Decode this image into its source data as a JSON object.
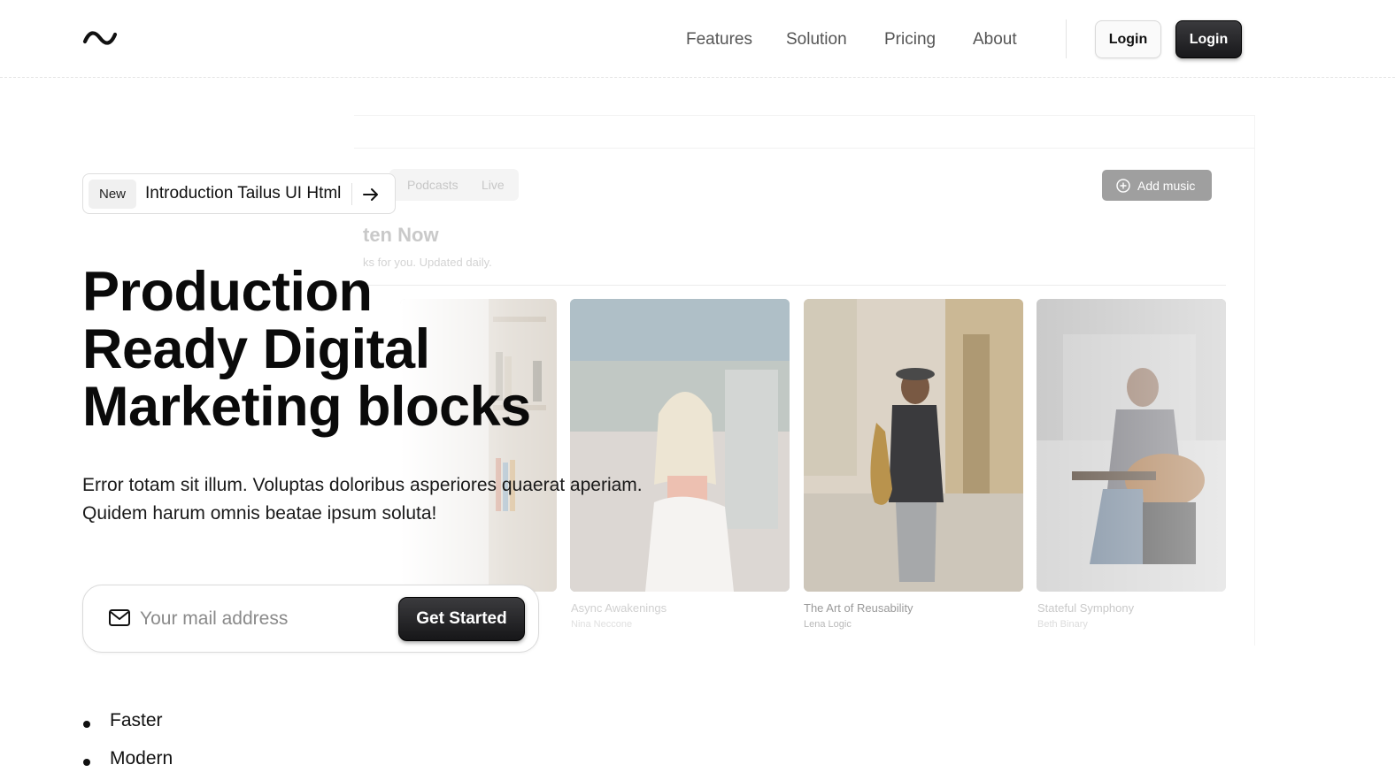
{
  "header": {
    "logo": "tilde-logo-icon",
    "nav": [
      "Features",
      "Solution",
      "Pricing",
      "About"
    ],
    "login_outline_label": "Login",
    "login_dark_label": "Login"
  },
  "badge": {
    "tag": "New",
    "text": "Introduction Tailus UI Html",
    "icon": "arrow-right-icon"
  },
  "hero": {
    "headline": [
      "Production",
      "Ready Digital",
      "Marketing blocks"
    ],
    "description_lines": [
      "Error totam sit illum. Voluptas doloribus asperiores quaerat aperiam.",
      "Quidem harum omnis beatae ipsum soluta!"
    ]
  },
  "signup": {
    "placeholder": "Your mail address",
    "button_label": "Get Started",
    "icon": "mail-icon"
  },
  "features": [
    "Faster",
    "Modern"
  ],
  "mockup": {
    "tabs": [
      "Podcasts",
      "Live"
    ],
    "add_button": "Add music",
    "heading": "ten Now",
    "subheading": "ks for you. Updated daily.",
    "albums": [
      {
        "title": "Async Awakenings",
        "artist": "Nina Neccone"
      },
      {
        "title": "The Art of Reusability",
        "artist": "Lena Logic"
      },
      {
        "title": "Stateful Symphony",
        "artist": "Beth Binary"
      }
    ]
  },
  "colors": {
    "primary_dark": "#18181b",
    "text": "#111111",
    "muted": "#555555"
  }
}
